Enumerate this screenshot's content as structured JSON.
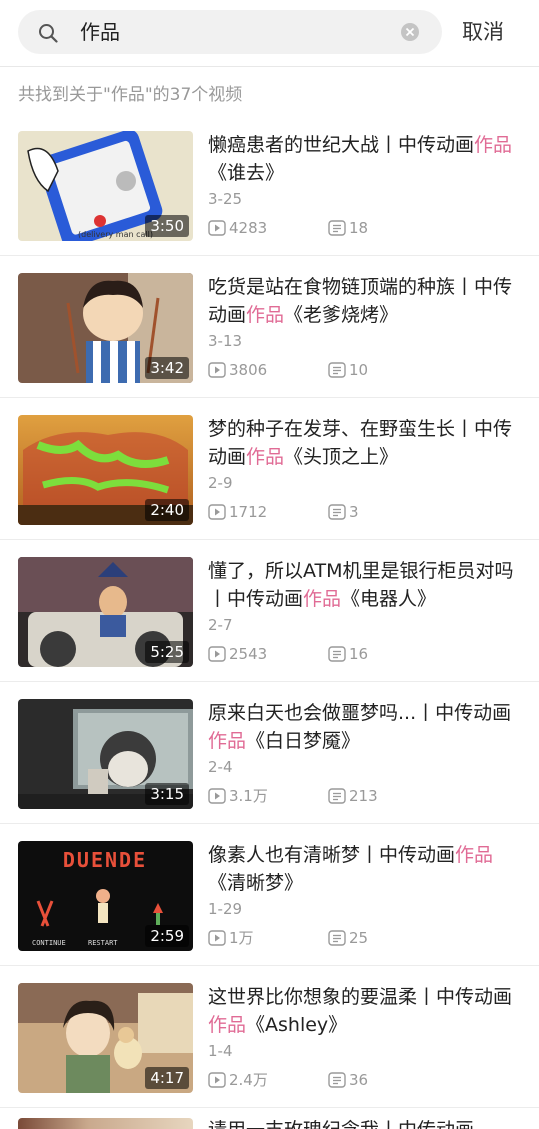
{
  "search": {
    "query": "作品",
    "cancel_label": "取消"
  },
  "summary": "共找到关于\"作品\"的37个视频",
  "items": [
    {
      "title_parts": [
        "懒癌患者的世纪大战丨中传动画",
        "作品",
        "《谁去》"
      ],
      "date": "3-25",
      "duration": "3:50",
      "plays": "4283",
      "comments": "18",
      "thumb_overlay": "(delivery man call)"
    },
    {
      "title_parts": [
        "吃货是站在食物链顶端的种族丨中传动画",
        "作品",
        "《老爹烧烤》"
      ],
      "date": "3-13",
      "duration": "3:42",
      "plays": "3806",
      "comments": "10"
    },
    {
      "title_parts": [
        "梦的种子在发芽、在野蛮生长丨中传动画",
        "作品",
        "《头顶之上》"
      ],
      "date": "2-9",
      "duration": "2:40",
      "plays": "1712",
      "comments": "3"
    },
    {
      "title_parts": [
        "懂了，所以ATM机里是银行柜员对吗丨中传动画",
        "作品",
        "《电器人》"
      ],
      "date": "2-7",
      "duration": "5:25",
      "plays": "2543",
      "comments": "16"
    },
    {
      "title_parts": [
        "原来白天也会做噩梦吗...丨中传动画",
        "作品",
        "《白日梦魇》"
      ],
      "date": "2-4",
      "duration": "3:15",
      "plays": "3.1万",
      "comments": "213"
    },
    {
      "title_parts": [
        "像素人也有清晰梦丨中传动画",
        "作品",
        "《清晰梦》"
      ],
      "date": "1-29",
      "duration": "2:59",
      "plays": "1万",
      "comments": "25",
      "thumb_overlay": "DUENDE",
      "thumb_caption_left": "CONTINUE",
      "thumb_caption_right": "RESTART"
    },
    {
      "title_parts": [
        "这世界比你想象的要温柔丨中传动画",
        "作品",
        "《Ashley》"
      ],
      "date": "1-4",
      "duration": "4:17",
      "plays": "2.4万",
      "comments": "36"
    }
  ],
  "partial_item": {
    "title": "请用一支玫瑰纪念我丨中传动画"
  },
  "colors": {
    "highlight": "#e06b95",
    "muted": "#999999"
  }
}
